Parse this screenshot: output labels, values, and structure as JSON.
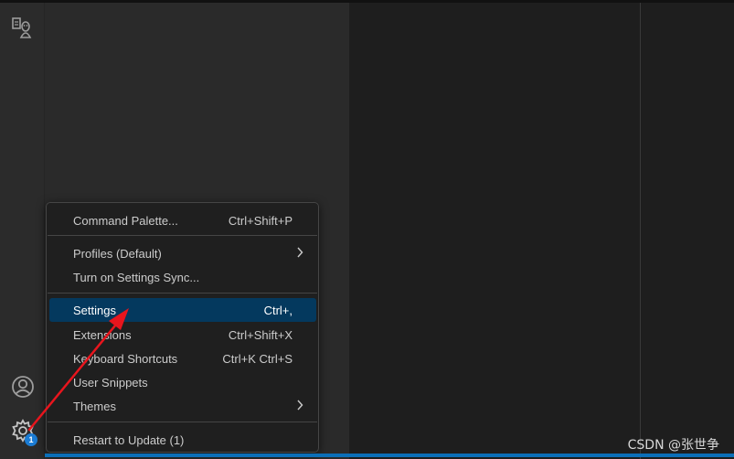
{
  "activity_bar": {
    "icons": [
      "remote-explorer-icon",
      "account-icon",
      "manage-gear-icon"
    ],
    "manage_badge": "1"
  },
  "manage_menu": {
    "items": [
      {
        "label": "Command Palette...",
        "shortcut": "Ctrl+Shift+P"
      },
      {
        "label": "Profiles (Default)",
        "submenu": true
      },
      {
        "label": "Turn on Settings Sync..."
      },
      {
        "label": "Settings",
        "shortcut": "Ctrl+,",
        "highlighted": true
      },
      {
        "label": "Extensions",
        "shortcut": "Ctrl+Shift+X"
      },
      {
        "label": "Keyboard Shortcuts",
        "shortcut": "Ctrl+K Ctrl+S"
      },
      {
        "label": "User Snippets"
      },
      {
        "label": "Themes",
        "submenu": true
      },
      {
        "label": "Restart to Update (1)"
      }
    ]
  },
  "annotation": {
    "arrow_color": "#e8151d"
  },
  "watermark": "CSDN @张世争",
  "colors": {
    "menu_background": "#1f1f1f",
    "highlight": "#04395e",
    "badge": "#1b7cd4",
    "status_bar": "#0b6fb8"
  }
}
